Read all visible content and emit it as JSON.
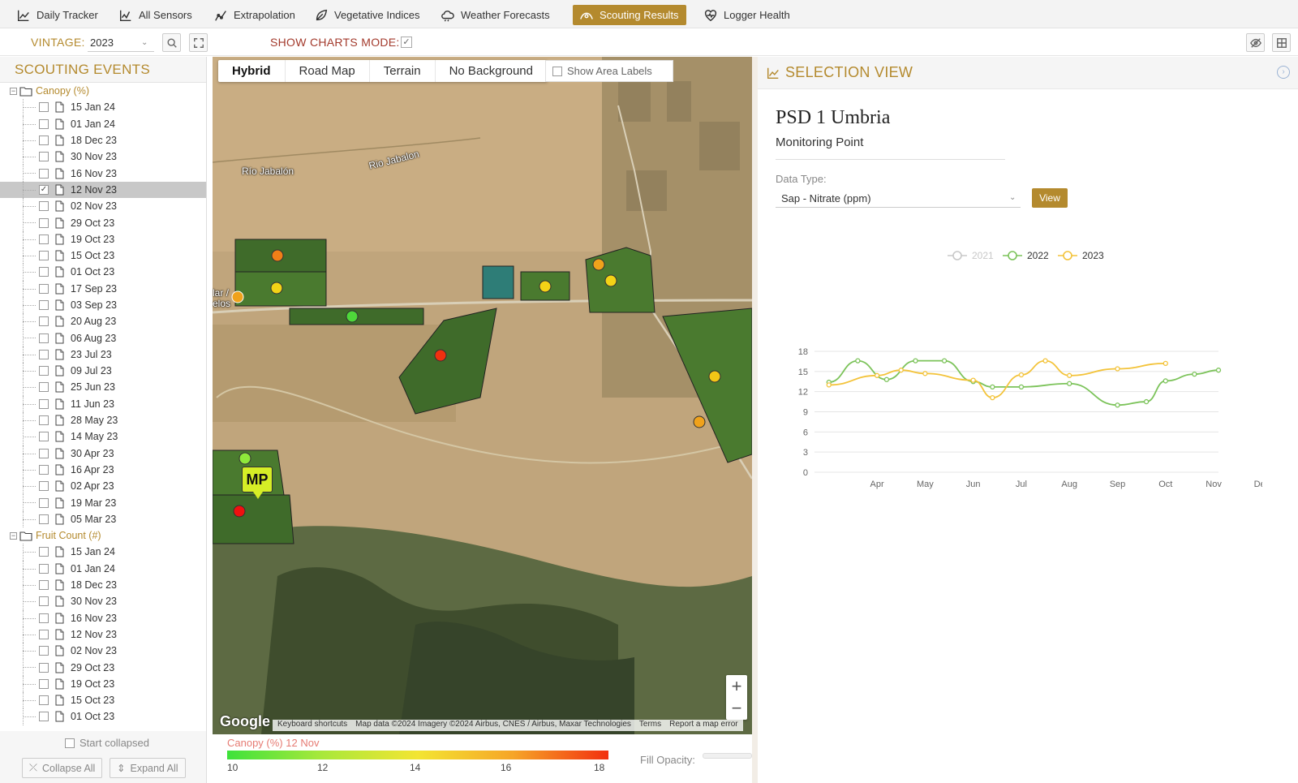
{
  "nav": {
    "tabs": [
      {
        "label": "Daily Tracker",
        "icon": "line-chart-icon"
      },
      {
        "label": "All Sensors",
        "icon": "line-chart-icon"
      },
      {
        "label": "Extrapolation",
        "icon": "extrapolation-icon"
      },
      {
        "label": "Vegetative Indices",
        "icon": "leaf-icon"
      },
      {
        "label": "Weather Forecasts",
        "icon": "cloud-icon"
      },
      {
        "label": "Scouting Results",
        "icon": "scouting-icon",
        "active": true
      },
      {
        "label": "Logger Health",
        "icon": "heart-pulse-icon"
      }
    ],
    "accent": "#b48a2e"
  },
  "toolbar": {
    "vintage_label": "VINTAGE:",
    "vintage_value": "2023",
    "show_charts_label": "SHOW CHARTS MODE:",
    "show_charts_checked": true
  },
  "left": {
    "title": "SCOUTING EVENTS",
    "groups": [
      {
        "label": "Canopy (%)",
        "items": [
          "15 Jan 24",
          "01 Jan 24",
          "18 Dec 23",
          "30 Nov 23",
          "16 Nov 23",
          "12 Nov 23",
          "02 Nov 23",
          "29 Oct 23",
          "19 Oct 23",
          "15 Oct 23",
          "01 Oct 23",
          "17 Sep 23",
          "03 Sep 23",
          "20 Aug 23",
          "06 Aug 23",
          "23 Jul 23",
          "09 Jul 23",
          "25 Jun 23",
          "11 Jun 23",
          "28 May 23",
          "14 May 23",
          "30 Apr 23",
          "16 Apr 23",
          "02 Apr 23",
          "19 Mar 23",
          "05 Mar 23"
        ],
        "selected": "12 Nov 23"
      },
      {
        "label": "Fruit Count (#)",
        "items": [
          "15 Jan 24",
          "01 Jan 24",
          "18 Dec 23",
          "30 Nov 23",
          "16 Nov 23",
          "12 Nov 23",
          "02 Nov 23",
          "29 Oct 23",
          "19 Oct 23",
          "15 Oct 23",
          "01 Oct 23"
        ]
      }
    ],
    "start_collapsed": "Start collapsed",
    "collapse_all": "Collapse All",
    "expand_all": "Expand All"
  },
  "map": {
    "types": [
      "Hybrid",
      "Road Map",
      "Terrain",
      "No Background"
    ],
    "active_type": "Hybrid",
    "show_area_labels": "Show Area Labels",
    "labels": {
      "rio1": "Río Jabalón",
      "rio2": "Rio Jabalon",
      "town": "lar / elos"
    },
    "marker": "MP",
    "google": "Google",
    "attribution": [
      "Keyboard shortcuts",
      "Map data ©2024 Imagery ©2024 Airbus, CNES / Airbus, Maxar Technologies",
      "Terms",
      "Report a map error"
    ],
    "legend": {
      "title": "Canopy (%) 12 Nov",
      "ticks": [
        "10",
        "12",
        "14",
        "16",
        "18"
      ],
      "fill_opacity": "Fill Opacity:"
    }
  },
  "selection": {
    "title": "SELECTION VIEW",
    "site_name": "PSD 1 Umbria",
    "site_type": "Monitoring Point",
    "data_type_label": "Data Type:",
    "data_type_value": "Sap - Nitrate (ppm)",
    "view_button": "View"
  },
  "chart_data": {
    "type": "line",
    "categories": [
      "Apr",
      "May",
      "Jun",
      "Jul",
      "Aug",
      "Sep",
      "Oct",
      "Nov",
      "Dec"
    ],
    "ylim": [
      0,
      18
    ],
    "yticks": [
      0,
      3,
      6,
      9,
      12,
      15,
      18
    ],
    "legend_placement": "top",
    "series": [
      {
        "name": "2021",
        "color": "#c8c8c8",
        "hidden": true,
        "x": [],
        "y": []
      },
      {
        "name": "2022",
        "color": "#7cc35a",
        "x": [
          3.0,
          3.6,
          4.2,
          4.8,
          5.4,
          6.0,
          6.4,
          7.0,
          8.0,
          9.0,
          9.6,
          10.0,
          10.6,
          11.1
        ],
        "y": [
          13.4,
          16.6,
          13.8,
          16.6,
          16.6,
          13.5,
          12.7,
          12.7,
          13.2,
          10.0,
          10.5,
          13.6,
          14.6,
          15.2
        ]
      },
      {
        "name": "2023",
        "color": "#f3c33a",
        "x": [
          3.0,
          4.0,
          4.5,
          5.0,
          6.0,
          6.4,
          7.0,
          7.5,
          8.0,
          9.0,
          10.0
        ],
        "y": [
          13.0,
          14.4,
          15.2,
          14.7,
          13.7,
          11.1,
          14.5,
          16.6,
          14.4,
          15.4,
          16.2
        ]
      }
    ]
  }
}
